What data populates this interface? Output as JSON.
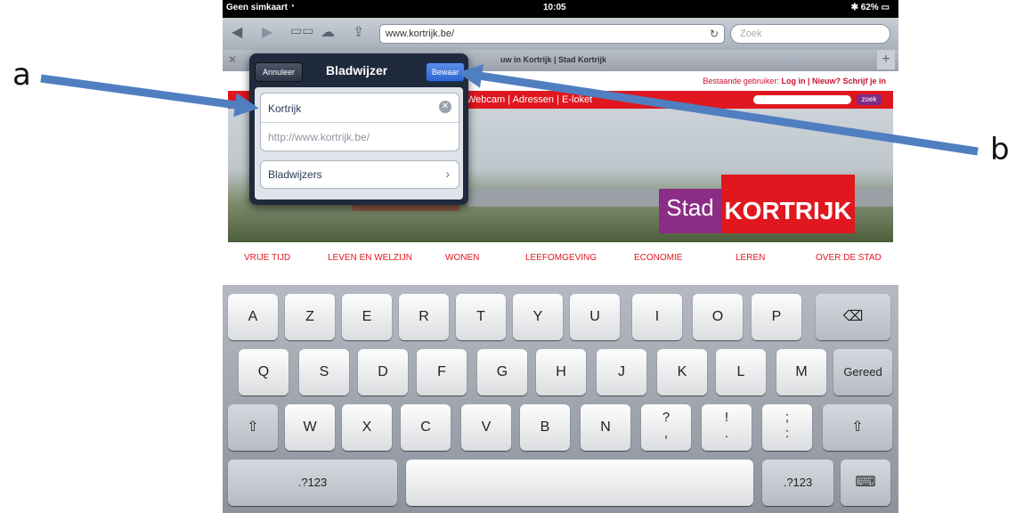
{
  "annotations": {
    "a": "a",
    "b": "b"
  },
  "statusbar": {
    "carrier": "Geen simkaart",
    "wifi_icon": "wifi-icon",
    "time": "10:05",
    "battery": "62%"
  },
  "toolbar": {
    "url": "www.kortrijk.be/",
    "search_placeholder": "Zoek",
    "icons": [
      "back-icon",
      "forward-icon",
      "bookmarks-icon",
      "icloud-icon",
      "share-icon",
      "reload-icon"
    ]
  },
  "tab": {
    "title": "uw in Kortrijk | Stad Kortrijk"
  },
  "web": {
    "login_prefix": "Bestaande gebruiker:",
    "login_link": "Log in",
    "register": "| Nieuw? Schrijf je in",
    "nav": "Webcam | Adressen | E-loket",
    "search_button": "zoek",
    "logo_stad": "Stad",
    "logo_kortrijk": "KORTRIJK",
    "categories": [
      "VRIJE TIJD",
      "LEVEN EN WELZIJN",
      "WONEN",
      "LEEFOMGEVING",
      "ECONOMIE",
      "LEREN",
      "OVER DE STAD"
    ]
  },
  "popover": {
    "cancel": "Annuleer",
    "title": "Bladwijzer",
    "save": "Bewaar",
    "bookmark_title": "Kortrijk",
    "bookmark_url": "http://www.kortrijk.be/",
    "folder": "Bladwijzers"
  },
  "keyboard": {
    "row1": [
      "A",
      "Z",
      "E",
      "R",
      "T",
      "Y",
      "U",
      "I",
      "O",
      "P"
    ],
    "row2": [
      "Q",
      "S",
      "D",
      "F",
      "G",
      "H",
      "J",
      "K",
      "L",
      "M"
    ],
    "row2_action": "Gereed",
    "row3": [
      "W",
      "X",
      "C",
      "V",
      "B",
      "N"
    ],
    "row3_punct": [
      [
        "?",
        ","
      ],
      [
        "!",
        "."
      ],
      [
        ";",
        ":"
      ]
    ],
    "numbers_key": ".?123"
  }
}
